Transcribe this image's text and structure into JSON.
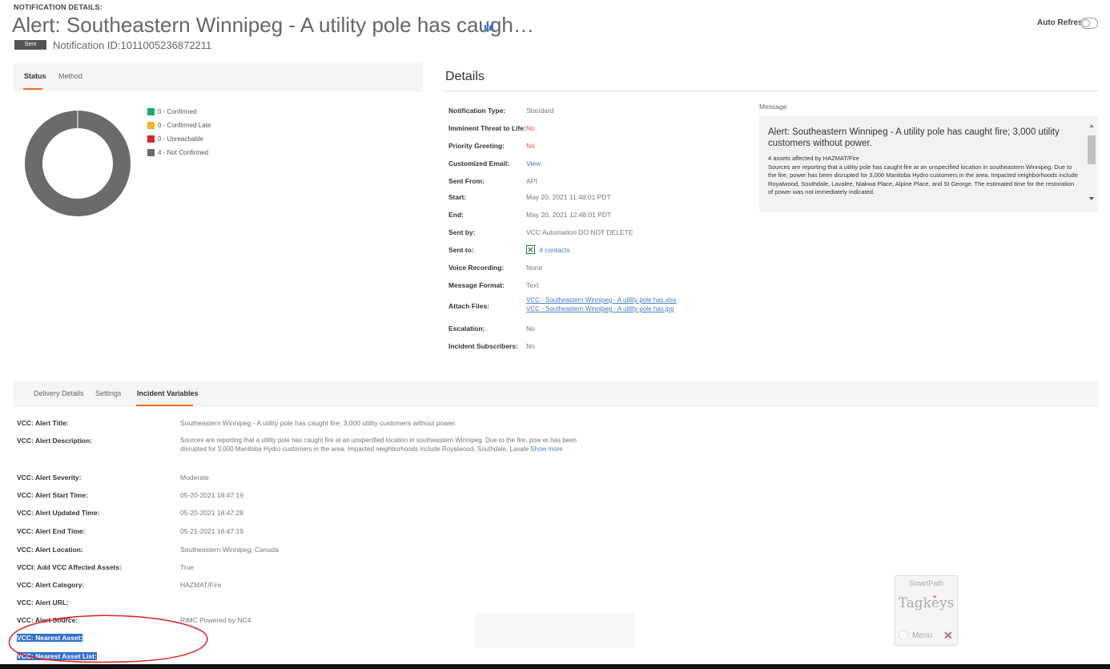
{
  "header": {
    "label": "NOTIFICATION DETAILS:",
    "title": "Alert: Southeastern Winnipeg - A utility pole has caugh…",
    "badge": "Sent",
    "notification_id": "Notification ID:1011005236872211",
    "auto_refresh": "Auto Refresh"
  },
  "status_panel": {
    "tabs": [
      "Status",
      "Method"
    ],
    "legend": [
      {
        "label": "0 - Confirmed",
        "color": "#1aaa6b"
      },
      {
        "label": "0 - Confirmed Late",
        "color": "#f0b429"
      },
      {
        "label": "0 - Unreachable",
        "color": "#d9272e"
      },
      {
        "label": "4 - Not Confirmed",
        "color": "#6b6b6b"
      }
    ]
  },
  "chart_data": {
    "type": "pie",
    "categories": [
      "Confirmed",
      "Confirmed Late",
      "Unreachable",
      "Not Confirmed"
    ],
    "values": [
      0,
      0,
      0,
      4
    ],
    "colors": [
      "#1aaa6b",
      "#f0b429",
      "#d9272e",
      "#6b6b6b"
    ],
    "donut": true
  },
  "details": {
    "title": "Details",
    "rows": [
      {
        "label": "Notification Type:",
        "value": "Standard"
      },
      {
        "label": "Imminent Threat to Life:",
        "value": "No"
      },
      {
        "label": "Priority Greeting:",
        "value": "No"
      },
      {
        "label": "Customized Email:",
        "value": "View"
      },
      {
        "label": "Sent From:",
        "value": "API"
      },
      {
        "label": "Start:",
        "value": "May 20, 2021 11:48:01 PDT"
      },
      {
        "label": "End:",
        "value": "May 20, 2021 12:48:01 PDT"
      },
      {
        "label": "Sent by:",
        "value": "VCC Automation DO NOT DELETE"
      },
      {
        "label": "Sent to:",
        "value": "4 contacts"
      },
      {
        "label": "Voice Recording:",
        "value": "None"
      },
      {
        "label": "Message Format:",
        "value": "Text"
      },
      {
        "label": "Attach Files:",
        "value": "VCC - Southeastern Winnipeg - A utility pole has.xlsx",
        "value2": "VCC - Southeastern Winnipeg - A utility pole has.jpg"
      },
      {
        "label": "Escalation:",
        "value": "No"
      },
      {
        "label": "Incident Subscribers:",
        "value": "No"
      }
    ],
    "message_label": "Message",
    "message_title": "Alert: Southeastern Winnipeg - A utility pole has caught fire; 3,000 utility customers without power.",
    "message_line1": "4 assets affected by HAZMAT/Fire",
    "message_body": "Sources are reporting that a utility pole has caught fire at an unspecified location in southeastern Winnipeg. Due to the fire, power has been disrupted for 3,000 Manitoba Hydro customers in the area. Impacted neighborhoods include Royalwood, Southdale, Lavalee, Niakwa Place, Alpine Place, and St George. The estimated time for the restoration of power was not immediately indicated."
  },
  "bottom_tabs": [
    "Delivery Details",
    "Settings",
    "Incident Variables"
  ],
  "variables": [
    {
      "label": "VCC: Alert Title:",
      "value": "Southeastern Winnipeg - A utility pole has caught fire; 3,000 utility customers without power."
    },
    {
      "label": "VCC: Alert Description:",
      "value": "Sources are reporting that a utility pole has caught fire at an unspecified location in southeastern Winnipeg. Due to the fire, pow er has been disrupted for 3,000 Manitoba Hydro customers in the area. Impacted neighborhoods include Royalwood, Southdale, Lavale",
      "link": "Show more"
    },
    {
      "label": "VCC: Alert Severity:",
      "value": "Moderate"
    },
    {
      "label": "VCC: Alert Start Time:",
      "value": "05-20-2021 18:47:19"
    },
    {
      "label": "VCC: Alert Updated Time:",
      "value": "05-20-2021 18:47:28"
    },
    {
      "label": "VCC: Alert End Time:",
      "value": "05-21-2021 18:47:19"
    },
    {
      "label": "VCC: Alert Location:",
      "value": "Southeastern Winnipeg, Canada"
    },
    {
      "label": "VCCI: Add VCC Affected Assets:",
      "value": "True"
    },
    {
      "label": "VCC: Alert Category:",
      "value": "HAZMAT/Fire"
    },
    {
      "label": "VCC: Alert URL:",
      "value": ""
    },
    {
      "label": "VCC: Alert Source:",
      "value": "RIMC Powered by NC4"
    },
    {
      "label": "VCC: Nearest Asset:",
      "value": ""
    },
    {
      "label": "VCC: Nearest Asset List:",
      "value": ""
    }
  ],
  "smartpath": {
    "title": "SmartPath",
    "brand": "Tagkeys",
    "menu": "Menu"
  },
  "icons": {
    "chart": "bar-chart-icon",
    "excel": "excel-file-icon",
    "close": "close-x-icon"
  }
}
